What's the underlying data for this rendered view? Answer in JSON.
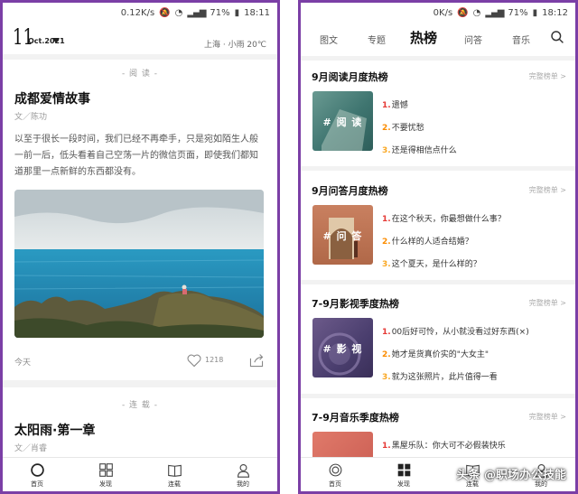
{
  "left": {
    "status": {
      "speed": "0.12K/s",
      "battery": "71%",
      "time": "18:11"
    },
    "header": {
      "day": "11",
      "month": "Oct.2021",
      "weather": "上海 · 小雨  20℃"
    },
    "article": {
      "tag": "- 阅 读 -",
      "title": "成都爱情故事",
      "author": "文／陈功",
      "excerpt": "以至于很长一段时间，我们已经不再牵手，只是宛如陌生人般一前一后，低头看着自己空荡一片的微信页面，即使我们都知道那里一点新鲜的东西都没有。",
      "date": "今天",
      "likes": "1218"
    },
    "serial": {
      "tag": "- 连 载 -",
      "title": "太阳雨·第一章",
      "author": "文／肖睿"
    },
    "tabs": [
      "首页",
      "发现",
      "连载",
      "我的"
    ]
  },
  "right": {
    "status": {
      "speed": "0K/s",
      "battery": "71%",
      "time": "18:12"
    },
    "nav": [
      "图文",
      "专题",
      "热榜",
      "问答",
      "音乐"
    ],
    "more_label": "完整榜单 >",
    "sections": [
      {
        "title": "9月阅读月度热榜",
        "thumb": "# 阅 读",
        "items": [
          "遗憾",
          "不要忧愁",
          "还是得相信点什么"
        ]
      },
      {
        "title": "9月问答月度热榜",
        "thumb": "# 问 答",
        "items": [
          "在这个秋天，你最想做什么事？",
          "什么样的人适合结婚？",
          "这个夏天，是什么样的？"
        ]
      },
      {
        "title": "7-9月影视季度热榜",
        "thumb": "# 影 视",
        "items": [
          "00后好可怜，从小就没看过好东西(×)",
          "她才是货真价实的\"大女主\"",
          "就为这张照片，此片值得一看"
        ]
      },
      {
        "title": "7-9月音乐季度热榜",
        "thumb": "",
        "items": [
          "黑屋乐队：你大可不必假装快乐",
          "",
          ""
        ]
      }
    ],
    "tabs": [
      "首页",
      "发现",
      "连载",
      "我的"
    ],
    "watermark": "头条 @职场办公技能"
  },
  "colors": {
    "frame": "#7b3fa6",
    "rank1": "#e53935",
    "rank2": "#fb8c00",
    "rank3": "#f9a825"
  }
}
